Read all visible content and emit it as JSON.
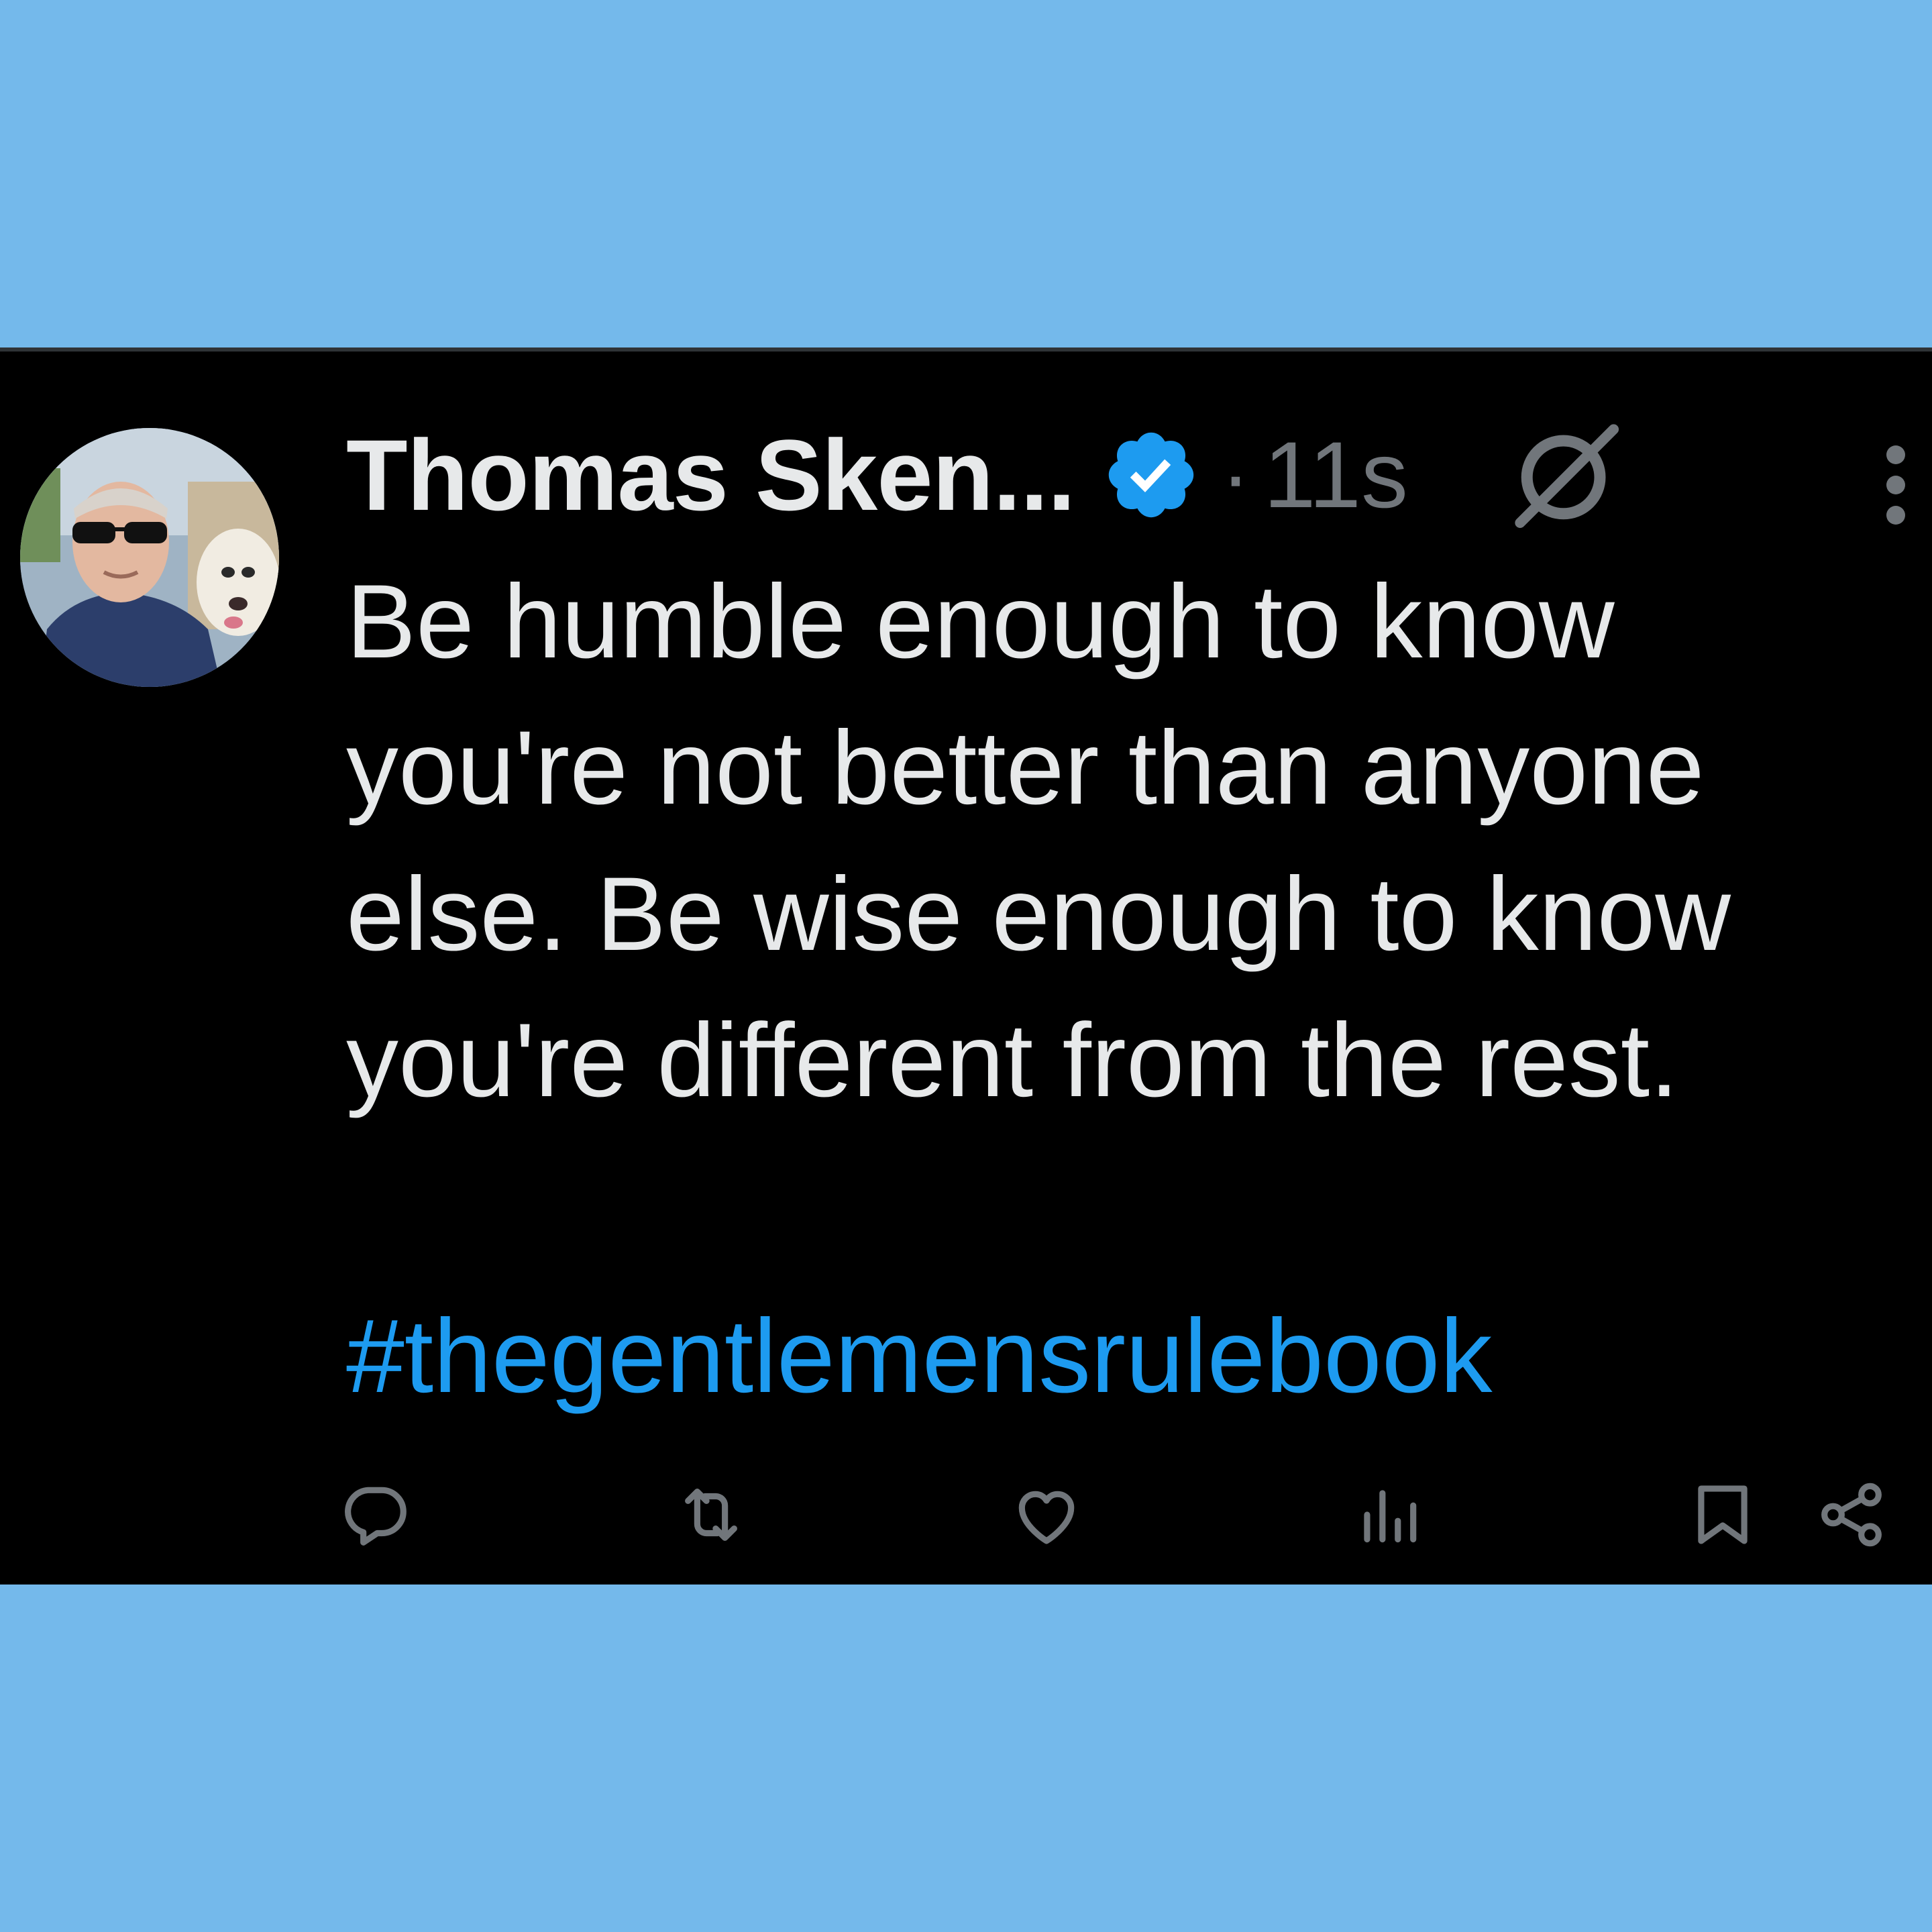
{
  "colors": {
    "background": "#74b9eb",
    "card": "#000000",
    "text_primary": "#e7e9ea",
    "text_secondary": "#71767b",
    "accent": "#1d9bf0"
  },
  "tweet": {
    "author_name": "Thomas Sken...",
    "verified_icon": "verified-badge-icon",
    "separator": "·",
    "timestamp": "11s",
    "grok_icon": "grok-icon",
    "more_icon": "more-vertical-icon",
    "text_lines": [
      "Be humble enough to know",
      "you're not better than anyone",
      "else. Be wise enough to know",
      "you're different from the rest."
    ],
    "hashtag": "#thegentlemensrulebook"
  },
  "actions": [
    {
      "name": "reply",
      "icon": "reply-icon"
    },
    {
      "name": "repost",
      "icon": "repost-icon"
    },
    {
      "name": "like",
      "icon": "heart-icon"
    },
    {
      "name": "views",
      "icon": "views-icon"
    },
    {
      "name": "bookmark",
      "icon": "bookmark-icon"
    },
    {
      "name": "share",
      "icon": "share-icon"
    }
  ]
}
